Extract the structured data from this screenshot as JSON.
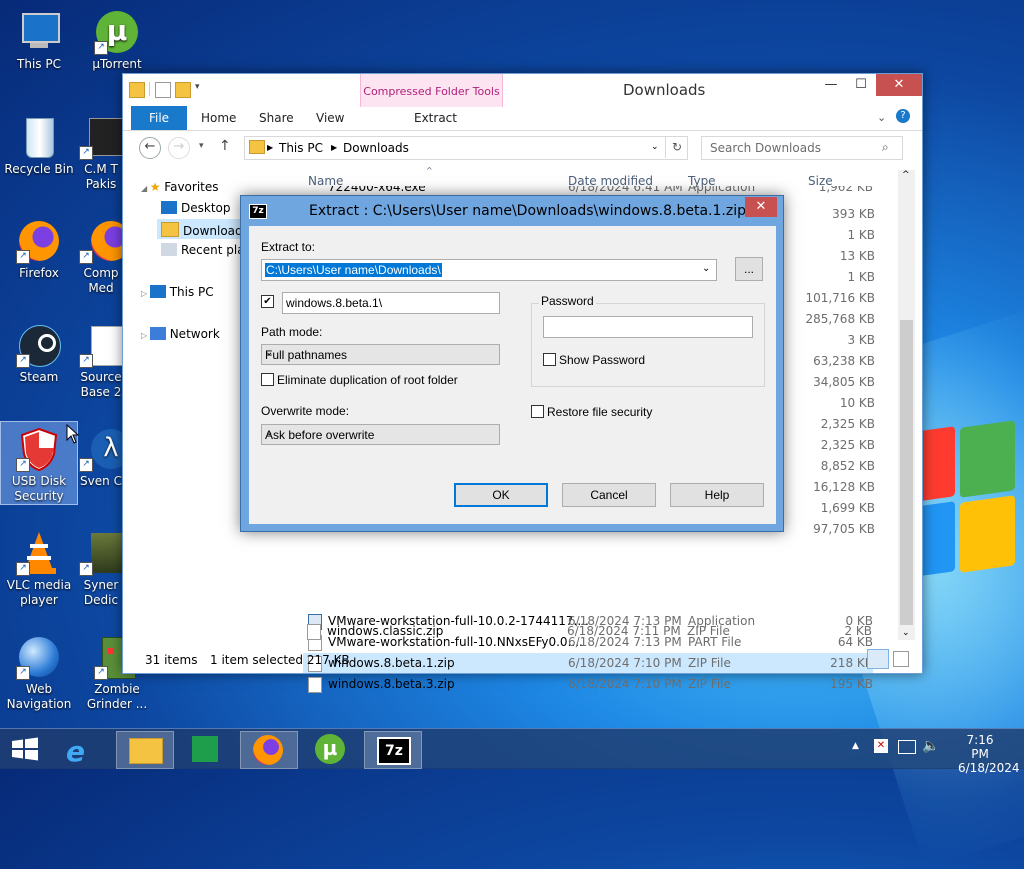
{
  "desktop": {
    "icons": [
      {
        "label": "This PC"
      },
      {
        "label": "µTorrent"
      },
      {
        "label": "Recycle Bin"
      },
      {
        "label": "C.M T Pakis"
      },
      {
        "label": "Firefox"
      },
      {
        "label": "Comp Med"
      },
      {
        "label": "Steam"
      },
      {
        "label": "Source Base 2"
      },
      {
        "label": "USB Disk Security"
      },
      {
        "label": "Sven C"
      },
      {
        "label": "VLC media player"
      },
      {
        "label": "Syner Dedic"
      },
      {
        "label": "Web Navigation"
      },
      {
        "label": "Zombie Grinder ..."
      }
    ]
  },
  "explorer": {
    "title": "Downloads",
    "context_tab": "Compressed Folder Tools",
    "tabs": [
      "File",
      "Home",
      "Share",
      "View",
      "Extract"
    ],
    "window_controls": {
      "minimize": "—",
      "maximize": "☐",
      "close": "✕"
    },
    "breadcrumb": [
      "This PC",
      "Downloads"
    ],
    "search_placeholder": "Search Downloads",
    "nav": {
      "favorites": "Favorites",
      "desktop": "Desktop",
      "downloads": "Downloads",
      "recent": "Recent plac",
      "this_pc": "This PC",
      "network": "Network"
    },
    "columns": {
      "name": "Name",
      "date": "Date modified",
      "type": "Type",
      "size": "Size"
    },
    "top_row": {
      "name": "722400-x64.exe",
      "date": "6/18/2024 6:41 AM",
      "type": "Application",
      "size": "1,962 KB"
    },
    "hidden_sizes": [
      "393 KB",
      "1 KB",
      "13 KB",
      "1 KB",
      "101,716 KB",
      "285,768 KB",
      "3 KB",
      "63,238 KB",
      "34,805 KB",
      "10 KB",
      "2,325 KB",
      "2,325 KB",
      "8,852 KB",
      "16,128 KB",
      "1,699 KB",
      "97,705 KB"
    ],
    "files": [
      {
        "name": "VMware-workstation-full-10.0.2-1744117....",
        "date": "6/18/2024 7:13 PM",
        "type": "Application",
        "size": "0 KB"
      },
      {
        "name": "VMware-workstation-full-10.NNxsEFy0.0....",
        "date": "6/18/2024 7:13 PM",
        "type": "PART File",
        "size": "64 KB"
      },
      {
        "name": "windows.8.beta.1.zip",
        "date": "6/18/2024 7:10 PM",
        "type": "ZIP File",
        "size": "218 KB"
      },
      {
        "name": "windows.8.beta.3.zip",
        "date": "6/18/2024 7:10 PM",
        "type": "ZIP File",
        "size": "195 KB"
      },
      {
        "name": "windows.classic.zip",
        "date": "6/18/2024 7:11 PM",
        "type": "ZIP File",
        "size": "2 KB"
      }
    ],
    "status": {
      "items": "31 items",
      "selected": "1 item selected  217 KB"
    }
  },
  "dialog": {
    "title": "Extract : C:\\Users\\User name\\Downloads\\windows.8.beta.1.zip",
    "app_icon": "7z",
    "extract_to_label": "Extract to:",
    "extract_to_value": "C:\\Users\\User name\\Downloads\\",
    "browse_label": "...",
    "subfolder_value": "windows.8.beta.1\\",
    "path_mode_label": "Path mode:",
    "path_mode_value": "Full pathnames",
    "eliminate_label": "Eliminate duplication of root folder",
    "overwrite_label": "Overwrite mode:",
    "overwrite_value": "Ask before overwrite",
    "password_label": "Password",
    "show_password_label": "Show Password",
    "restore_security_label": "Restore file security",
    "ok": "OK",
    "cancel": "Cancel",
    "help": "Help"
  },
  "taskbar": {
    "time": "7:16 PM",
    "date": "6/18/2024",
    "seven_zip": "7z"
  }
}
